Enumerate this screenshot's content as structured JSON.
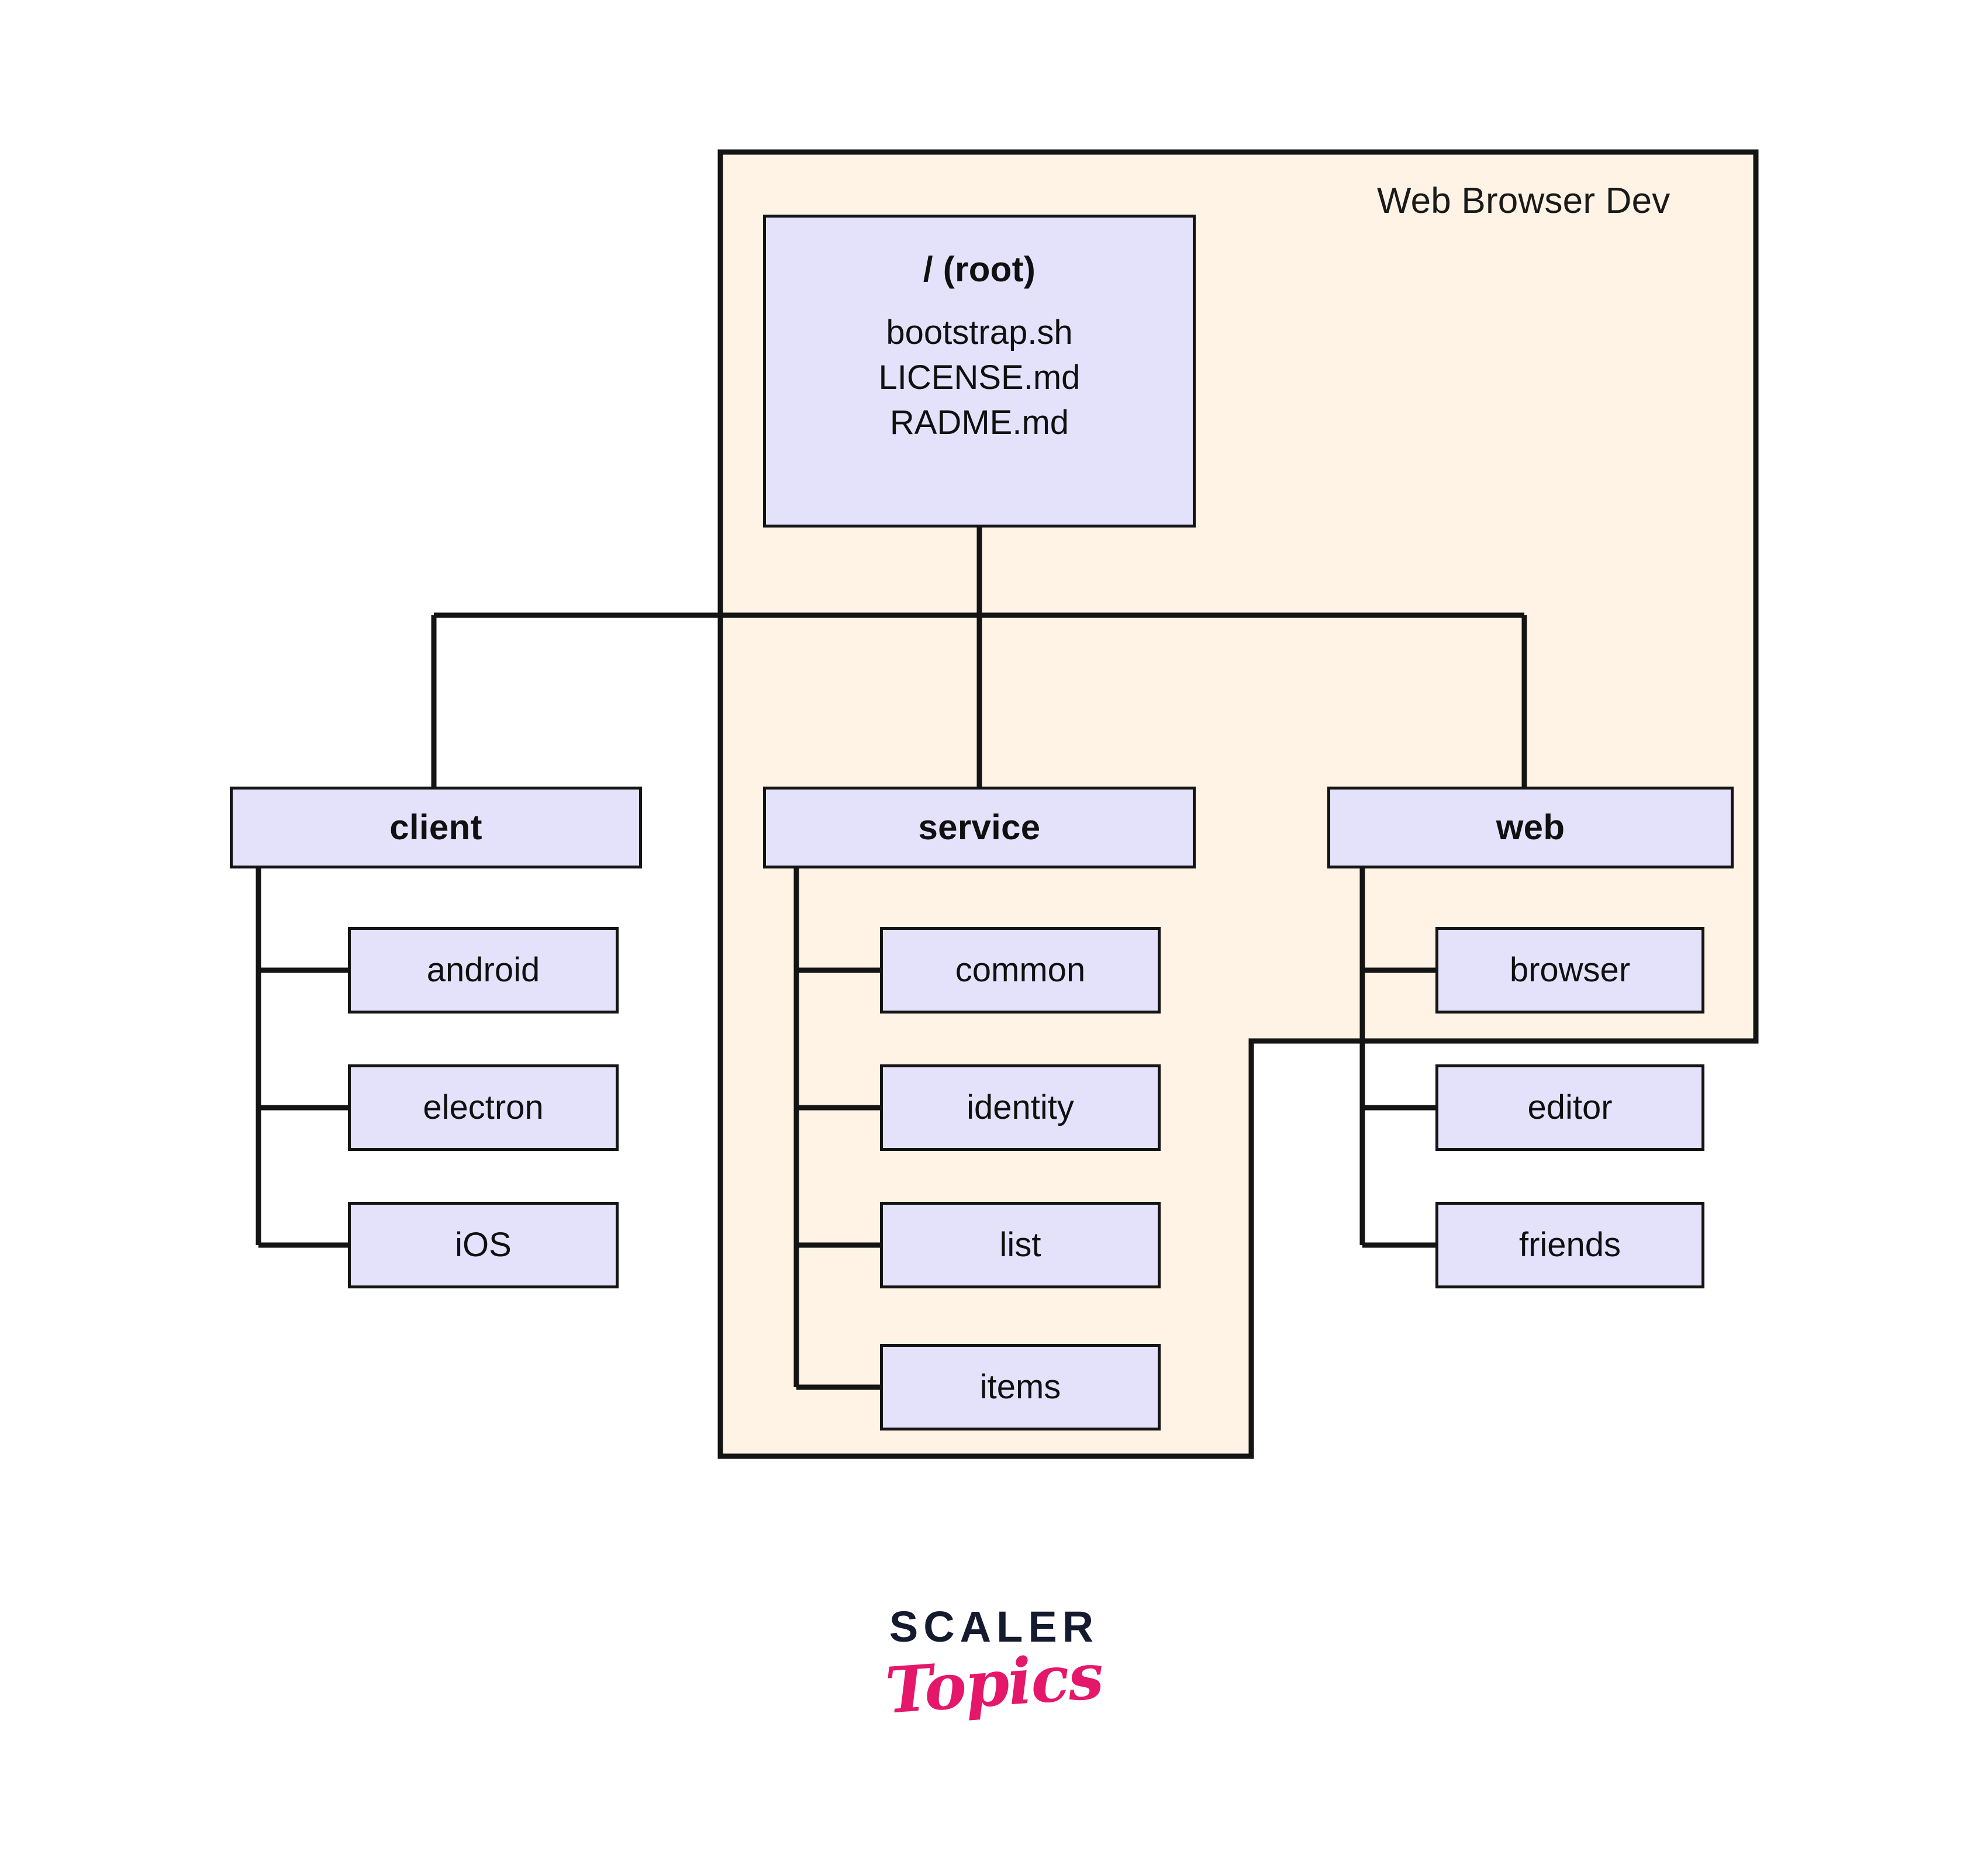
{
  "region": {
    "label": "Web Browser Dev",
    "fill": "#FEF3E4",
    "stroke": "#141414"
  },
  "colors": {
    "node_fill": "#E4E1FB",
    "node_stroke": "#141414",
    "connector": "#141414",
    "text": "#101010",
    "logo_dark": "#151B2E",
    "logo_pink": "#E4176A",
    "page_background": "#FFFFFF"
  },
  "tree": {
    "root": {
      "title": "/ (root)",
      "files": [
        "bootstrap.sh",
        "LICENSE.md",
        "RADME.md"
      ]
    },
    "branches": [
      {
        "label": "client",
        "children": [
          {
            "label": "android"
          },
          {
            "label": "electron"
          },
          {
            "label": "iOS"
          }
        ]
      },
      {
        "label": "service",
        "children": [
          {
            "label": "common"
          },
          {
            "label": "identity"
          },
          {
            "label": "list"
          },
          {
            "label": "items"
          }
        ]
      },
      {
        "label": "web",
        "children": [
          {
            "label": "browser"
          },
          {
            "label": "editor"
          },
          {
            "label": "friends"
          }
        ]
      }
    ]
  },
  "logo": {
    "primary": "SCALER",
    "secondary": "Topics"
  }
}
